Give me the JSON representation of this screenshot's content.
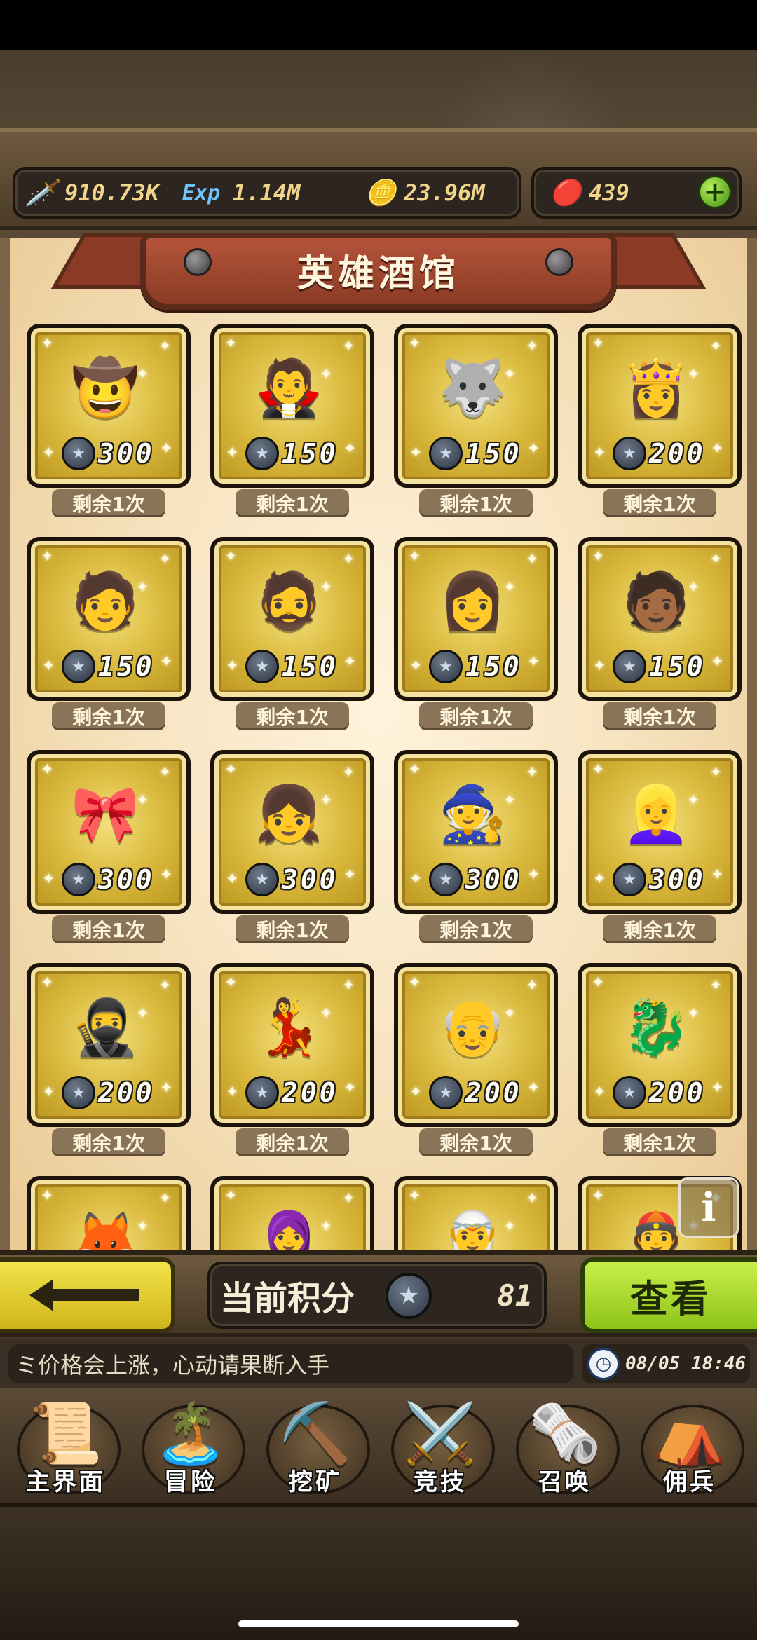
{
  "resources": {
    "attack": {
      "icon": "sword-icon",
      "value": "910.73K"
    },
    "exp": {
      "icon": "exp-icon",
      "label": "Exp",
      "value": "1.14M"
    },
    "gold": {
      "icon": "gold-coin-icon",
      "value": "23.96M"
    },
    "gems": {
      "icon": "ruby-icon",
      "value": "439"
    }
  },
  "title": "英雄酒馆",
  "heroes": [
    {
      "emoji": "🤠",
      "cost": "300",
      "remaining": "剩余1次"
    },
    {
      "emoji": "🧛",
      "cost": "150",
      "remaining": "剩余1次"
    },
    {
      "emoji": "🐺",
      "cost": "150",
      "remaining": "剩余1次"
    },
    {
      "emoji": "👸",
      "cost": "200",
      "remaining": "剩余1次"
    },
    {
      "emoji": "🧑",
      "cost": "150",
      "remaining": "剩余1次"
    },
    {
      "emoji": "🧔",
      "cost": "150",
      "remaining": "剩余1次"
    },
    {
      "emoji": "👩",
      "cost": "150",
      "remaining": "剩余1次"
    },
    {
      "emoji": "🧑🏾",
      "cost": "150",
      "remaining": "剩余1次"
    },
    {
      "emoji": "🎀",
      "cost": "300",
      "remaining": "剩余1次"
    },
    {
      "emoji": "👧",
      "cost": "300",
      "remaining": "剩余1次"
    },
    {
      "emoji": "🧙",
      "cost": "300",
      "remaining": "剩余1次"
    },
    {
      "emoji": "👱‍♀️",
      "cost": "300",
      "remaining": "剩余1次"
    },
    {
      "emoji": "🥷",
      "cost": "200",
      "remaining": "剩余1次"
    },
    {
      "emoji": "💃",
      "cost": "200",
      "remaining": "剩余1次"
    },
    {
      "emoji": "👴",
      "cost": "200",
      "remaining": "剩余1次"
    },
    {
      "emoji": "🐉",
      "cost": "200",
      "remaining": "剩余1次"
    },
    {
      "emoji": "🦊",
      "cost": "",
      "remaining": ""
    },
    {
      "emoji": "🧕",
      "cost": "",
      "remaining": ""
    },
    {
      "emoji": "🧝",
      "cost": "",
      "remaining": ""
    },
    {
      "emoji": "👲",
      "cost": "",
      "remaining": ""
    }
  ],
  "info_icon": "info-icon",
  "action_bar": {
    "back_icon": "back-arrow-icon",
    "score_label": "当前积分",
    "score_value": "81",
    "view_label": "查看"
  },
  "ticker": {
    "text": "ミ价格会上涨，心动请果断入手",
    "datetime": "08/05 18:46"
  },
  "nav": [
    {
      "icon": "scroll-map-icon",
      "emoji": "📜",
      "label": "主界面"
    },
    {
      "icon": "island-icon",
      "emoji": "🏝️",
      "label": "冒险"
    },
    {
      "icon": "pickaxe-icon",
      "emoji": "⛏️",
      "label": "挖矿"
    },
    {
      "icon": "crossed-swords-icon",
      "emoji": "⚔️",
      "label": "竞技"
    },
    {
      "icon": "summon-scroll-icon",
      "emoji": "🗞️",
      "label": "召唤"
    },
    {
      "icon": "tent-icon",
      "emoji": "⛺",
      "label": "佣兵"
    }
  ]
}
